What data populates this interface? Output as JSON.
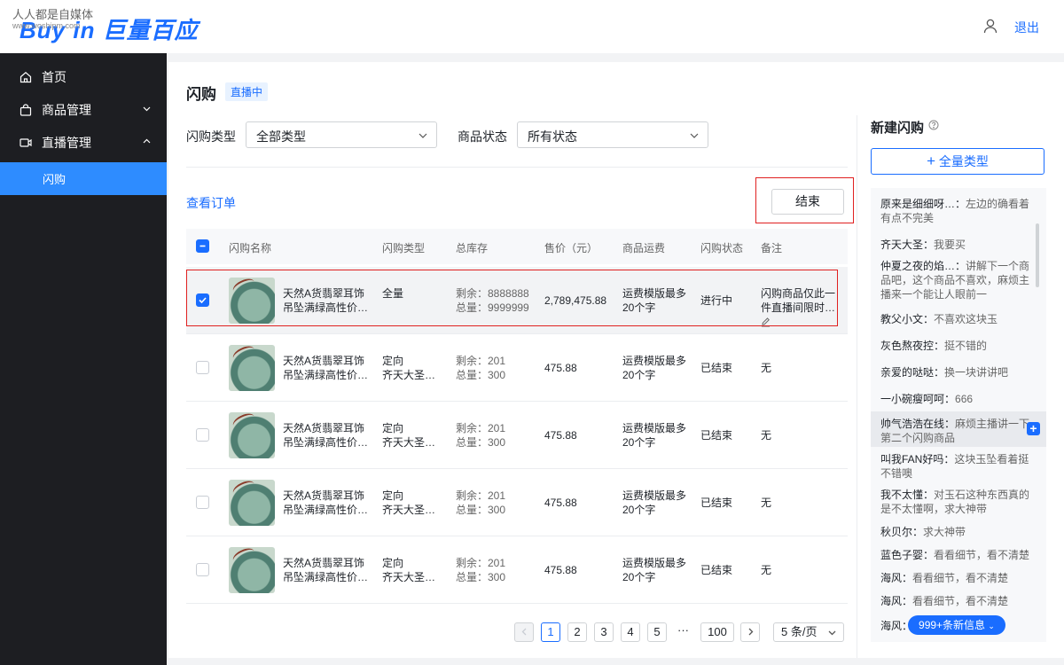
{
  "header": {
    "watermark": "人人都是自媒体",
    "watermark_url": "www.woshipm.com",
    "logo": "Buy in 巨量百应",
    "logout": "退出"
  },
  "sidebar": {
    "items": [
      {
        "label": "首页"
      },
      {
        "label": "商品管理"
      },
      {
        "label": "直播管理"
      }
    ],
    "sub_items": [
      {
        "label": "闪购"
      }
    ]
  },
  "page": {
    "title": "闪购",
    "badge": "直播中",
    "filters": {
      "type_label": "闪购类型",
      "type_value": "全部类型",
      "status_label": "商品状态",
      "status_value": "所有状态"
    },
    "view_orders": "查看订单",
    "end_button": "结束"
  },
  "table": {
    "headers": [
      "闪购名称",
      "闪购类型",
      "总库存",
      "售价（元）",
      "商品运费",
      "闪购状态",
      "备注"
    ],
    "rows": [
      {
        "name": "天然A货翡翠耳饰吊坠满绿高性价…",
        "type1": "全量",
        "type2": "",
        "stock1": "剩余：8888888",
        "stock2": "总量：9999999",
        "price": "2,789,475.88",
        "freight": "运费模版最多20个字",
        "status": "进行中",
        "note": "闪购商品仅此一件直播间限时…",
        "checked": true
      },
      {
        "name": "天然A货翡翠耳饰吊坠满绿高性价…",
        "type1": "定向",
        "type2": "齐天大圣…",
        "stock1": "剩余：201",
        "stock2": "总量：300",
        "price": "475.88",
        "freight": "运费模版最多20个字",
        "status": "已结束",
        "note": "无",
        "checked": false
      },
      {
        "name": "天然A货翡翠耳饰吊坠满绿高性价…",
        "type1": "定向",
        "type2": "齐天大圣…",
        "stock1": "剩余：201",
        "stock2": "总量：300",
        "price": "475.88",
        "freight": "运费模版最多20个字",
        "status": "已结束",
        "note": "无",
        "checked": false
      },
      {
        "name": "天然A货翡翠耳饰吊坠满绿高性价…",
        "type1": "定向",
        "type2": "齐天大圣…",
        "stock1": "剩余：201",
        "stock2": "总量：300",
        "price": "475.88",
        "freight": "运费模版最多20个字",
        "status": "已结束",
        "note": "无",
        "checked": false
      },
      {
        "name": "天然A货翡翠耳饰吊坠满绿高性价…",
        "type1": "定向",
        "type2": "齐天大圣…",
        "stock1": "剩余：201",
        "stock2": "总量：300",
        "price": "475.88",
        "freight": "运费模版最多20个字",
        "status": "已结束",
        "note": "无",
        "checked": false
      }
    ]
  },
  "pagination": {
    "pages": [
      "1",
      "2",
      "3",
      "4",
      "5"
    ],
    "dots": "···",
    "last": "100",
    "page_size": "5 条/页"
  },
  "right_panel": {
    "title": "新建闪购",
    "add_button": "全量类型",
    "new_messages": "999+条新信息",
    "comments": [
      {
        "user": "原来是细细呀…：",
        "text": "左边的确看着有点不完美"
      },
      {
        "user": "齐天大圣：",
        "text": "我要买"
      },
      {
        "user": "仲夏之夜的焰…：",
        "text": "讲解下一个商品吧，这个商品不喜欢，麻烦主播来一个能让人眼前一"
      },
      {
        "user": "教父小文：",
        "text": "不喜欢这块玉"
      },
      {
        "user": "灰色熬夜控：",
        "text": "挺不错的"
      },
      {
        "user": "亲爱的哒哒：",
        "text": "换一块讲讲吧"
      },
      {
        "user": "一小碗瘦呵呵：",
        "text": "666"
      },
      {
        "user": "帅气浩浩在线：",
        "text": "麻烦主播讲一下第二个闪购商品"
      },
      {
        "user": "叫我FAN好吗：",
        "text": "这块玉坠看着挺不错噢"
      },
      {
        "user": "我不太懂：",
        "text": "对玉石这种东西真的是不太懂啊，求大神带"
      },
      {
        "user": "秋贝尔：",
        "text": "求大神带"
      },
      {
        "user": "蓝色子婴：",
        "text": "看看细节，看不清楚"
      },
      {
        "user": "海风：",
        "text": "看看细节，看不清楚"
      },
      {
        "user": "海风：",
        "text": "看看细节，看不清楚"
      },
      {
        "user": "海风：",
        "text": ""
      }
    ]
  }
}
